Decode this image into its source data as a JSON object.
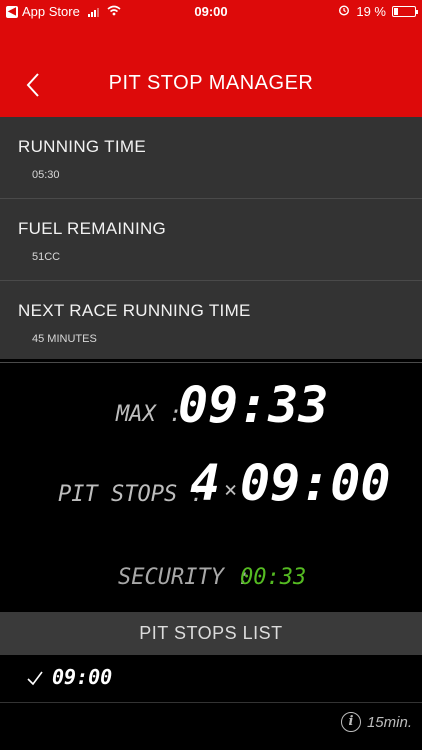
{
  "status_bar": {
    "carrier": "App Store",
    "time": "09:00",
    "battery": "19 %",
    "battery_level": 0.19
  },
  "header": {
    "title": "PIT STOP MANAGER"
  },
  "settings": [
    {
      "label": "RUNNING TIME",
      "value": "05:30"
    },
    {
      "label": "FUEL REMAINING",
      "value": "51CC"
    },
    {
      "label": "NEXT RACE RUNNING TIME",
      "value": "45 MINUTES"
    }
  ],
  "summary": {
    "max_label": "MAX :",
    "max_value": "09:33",
    "pit_stops_label": "PIT STOPS :",
    "pit_stops_count": "4",
    "multiply": "×",
    "pit_stop_time": "09:00",
    "security_label": "SECURITY :",
    "security_value": "00:33",
    "security_color": "#55bb22"
  },
  "list": {
    "title": "PIT STOPS LIST",
    "items": [
      {
        "time": "09:00",
        "checked": true,
        "duration": "15min."
      }
    ]
  },
  "colors": {
    "accent": "#dd0a0a"
  }
}
